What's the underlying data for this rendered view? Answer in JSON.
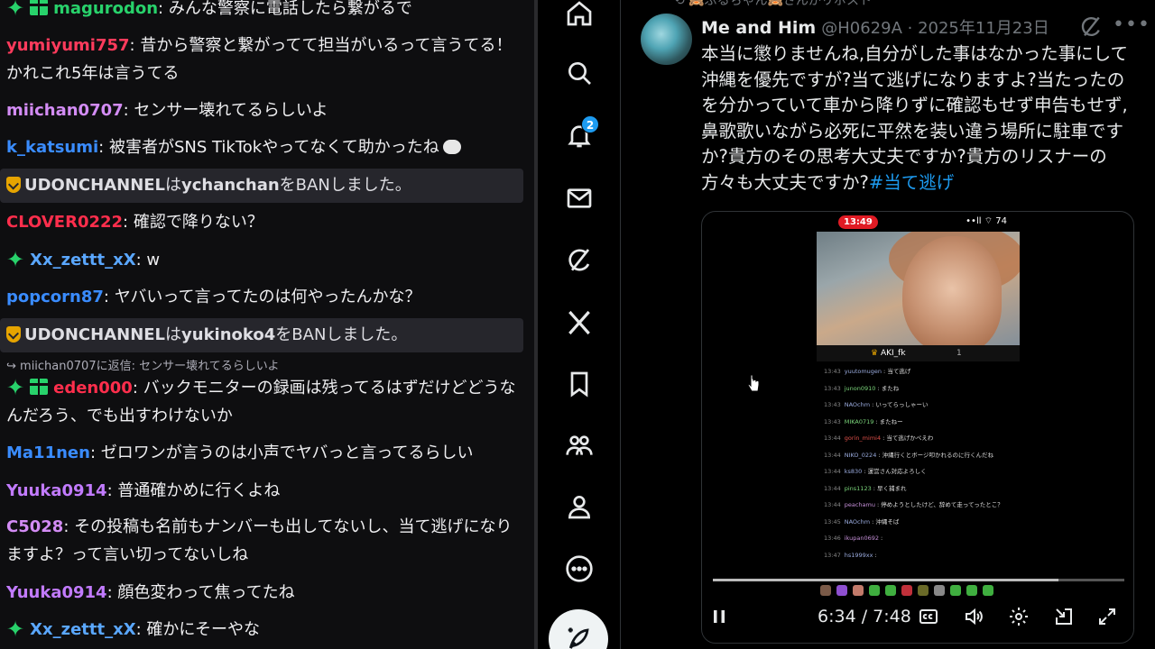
{
  "chat": {
    "messages": [
      {
        "user": "magurodon",
        "color": "#28d26b",
        "text": ": みんな警察に電話したら繋がるで",
        "badges": [
          "star",
          "gift"
        ]
      },
      {
        "user": "yumiyumi757",
        "color": "#ff3b5c",
        "text": ": 昔から警察と繋がってて担当がいるって言うてる！かれこれ5年は言うてる",
        "badges": []
      },
      {
        "user": "miichan0707",
        "color": "#d38cf5",
        "text": ": センサー壊れてるらしいよ",
        "badges": []
      },
      {
        "user": "k_katsumi",
        "color": "#3a8cff",
        "text": ": 被害者がSNS TikTokやってなくて助かったね",
        "badges": []
      },
      {
        "user": "CLOVER0222",
        "color": "#ff2e4c",
        "text": ": 確認で降りない？",
        "badges": []
      },
      {
        "user": "Xx_zettt_xX",
        "color": "#5aa7ff",
        "text": ": w",
        "badges": [
          "star"
        ]
      },
      {
        "user": "popcorn87",
        "color": "#3a8cff",
        "text": ": ヤバいって言ってたのは何やったんかな？",
        "badges": []
      },
      {
        "user": "eden000",
        "color": "#ff2e4c",
        "text": ": バックモニターの録画は残ってるはずだけどどうなんだろう、でも出すわけないか",
        "badges": [
          "star",
          "gift"
        ]
      },
      {
        "user": "Ma11nen",
        "color": "#3a8cff",
        "text": ": ゼロワンが言うのは小声でヤバっと言ってるらしい",
        "badges": []
      },
      {
        "user": "Yuuka0914",
        "color": "#c27bff",
        "text": ": 普通確かめに行くよね",
        "badges": []
      },
      {
        "user": "C5028",
        "color": "#d38cf5",
        "text": ": その投稿も名前もナンバーも出してないし、当て逃げになりますよ？って言い切ってないしね",
        "badges": []
      },
      {
        "user": "Yuuka0914",
        "color": "#c27bff",
        "text": ": 顔色変わって焦ってたね",
        "badges": []
      },
      {
        "user": "Xx_zettt_xX",
        "color": "#5aa7ff",
        "text": ": 確かにそーやな",
        "badges": [
          "star"
        ]
      }
    ],
    "system": [
      {
        "mod": "UDONCHANNEL",
        "mid": "は",
        "target": "ychanchan",
        "tail": "をBANしました。"
      },
      {
        "mod": "UDONCHANNEL",
        "mid": "は",
        "target": "yukinoko4",
        "tail": "をBANしました。"
      }
    ],
    "reply_ref": "↪ miichan0707に返信: センサー壊れてるらしいよ"
  },
  "nav": {
    "items": [
      "home-icon",
      "explore-icon",
      "notifications-icon",
      "messages-icon",
      "grok-icon",
      "x-premium-icon",
      "bookmarks-icon",
      "communities-icon",
      "profile-icon",
      "more-icon"
    ],
    "notifications_count": "2",
    "compose_icon": "compose-feather-icon"
  },
  "post": {
    "repost_line": "⟲ 🙈ぷるちゃん🙈さんがリポスト",
    "author_name": "Me and Him",
    "author_handle": "@H0629A",
    "separator": " · ",
    "date": "2025年11月23日",
    "text": "本当に懲りませんね,自分がした事はなかった事にして沖縄を優先ですが?当て逃げになりますよ?当たったのを分かっていて車から降りずに確認もせず申告もせず,鼻歌歌いながら必死に平然を装い違う場所に駐車ですか?貴方のその思考大丈夫ですか?貴方のリスナーの方々も大丈夫ですか?",
    "hashtag": "#当て逃げ"
  },
  "video": {
    "phone_time": "13:49",
    "phone_status": "••ll ⌔ 74",
    "streamer": "AKI_fk",
    "viewer_count": "1",
    "chat_lines": [
      {
        "t": "13:43",
        "u": "yuutomugen",
        "c": "",
        "m": "当て逃げ"
      },
      {
        "t": "13:43",
        "u": "junon0910",
        "c": "g",
        "m": "またね"
      },
      {
        "t": "13:43",
        "u": "NAOchm",
        "c": "",
        "m": "いってらっしゃーい"
      },
      {
        "t": "13:43",
        "u": "MIKA0719",
        "c": "g",
        "m": "またねー"
      },
      {
        "t": "13:44",
        "u": "gorin_mimi4",
        "c": "r",
        "m": "当て逃げかペえわ"
      },
      {
        "t": "13:44",
        "u": "NIKO_0224",
        "c": "",
        "m": "沖縄行くとボージ叩かれるのに行くんだね"
      },
      {
        "t": "13:44",
        "u": "ks830",
        "c": "",
        "m": "運営さん対応よろしく"
      },
      {
        "t": "13:44",
        "u": "pins1123",
        "c": "g",
        "m": "早く捕まれ"
      },
      {
        "t": "13:44",
        "u": "peachamu",
        "c": "p",
        "m": "停めようとしたけど、辞めて走ってったとこ？"
      },
      {
        "t": "13:45",
        "u": "NAOchm",
        "c": "",
        "m": "沖縄そば"
      },
      {
        "t": "13:46",
        "u": "ikupan0692",
        "c": "p",
        "m": ""
      },
      {
        "t": "13:47",
        "u": "hs1999xx",
        "c": "",
        "m": ""
      }
    ],
    "progress_fraction": 0.84,
    "current_time": "6:34",
    "duration": "7:48",
    "time_sep": " / "
  }
}
